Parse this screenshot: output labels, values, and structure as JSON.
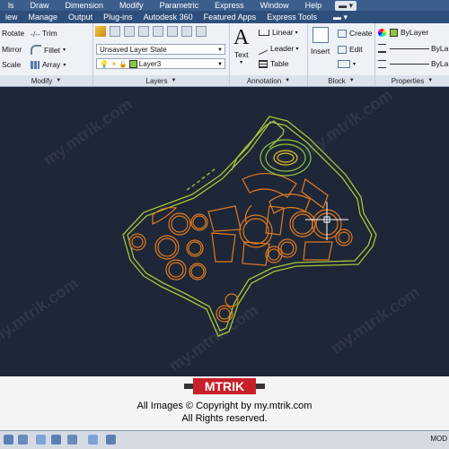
{
  "menubar": [
    "ls",
    "Draw",
    "Dimension",
    "Modify",
    "Parametric",
    "Express",
    "Window",
    "Help"
  ],
  "ribbon_tabs": [
    "iew",
    "Manage",
    "Output",
    "Plug-ins",
    "Autodesk 360",
    "Featured Apps",
    "Express Tools"
  ],
  "modify": {
    "rotate": "Rotate",
    "mirror": "Mirror",
    "scale": "Scale",
    "trim": "Trim",
    "fillet": "Fillet",
    "array": "Array",
    "title": "Modify"
  },
  "layers": {
    "state": "Unsaved Layer State",
    "current": "Layer3",
    "title": "Layers"
  },
  "annotation": {
    "text": "Text",
    "linear": "Linear",
    "leader": "Leader",
    "table": "Table",
    "title": "Annotation"
  },
  "block": {
    "insert": "Insert",
    "create": "Create",
    "edit": "Edit",
    "title": "Block"
  },
  "properties": {
    "bylayer": "ByLayer",
    "bylayer2": "ByLa",
    "bylayer3": "ByLa",
    "title": "Properties"
  },
  "watermark": "my.mtrik.com",
  "footer": {
    "logo": "MTRIK",
    "line1": "All Images © Copyright by my.mtrik.com",
    "line2": "All Rights reserved."
  },
  "status": {
    "mode": "MOD"
  },
  "colors": {
    "drawing_outer": "#a7c43a",
    "drawing_inner": "#e07a1f",
    "accent_green": "#8dc63f"
  }
}
